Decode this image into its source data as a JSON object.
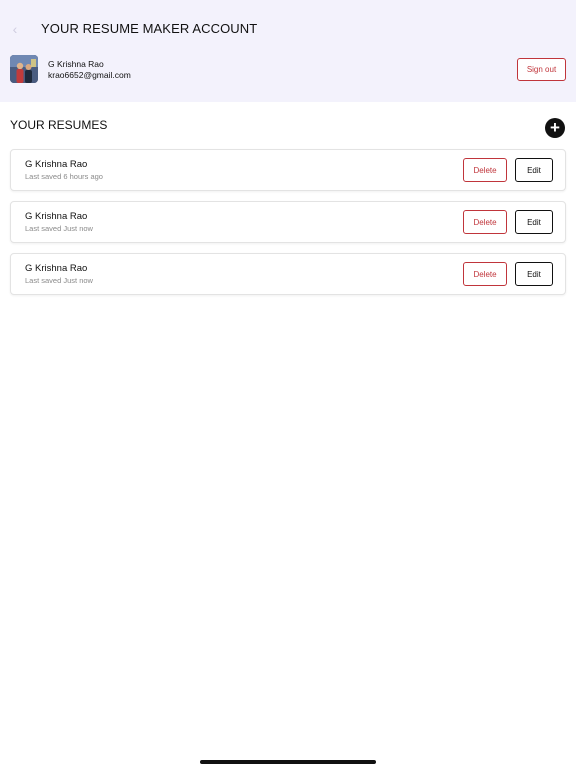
{
  "header": {
    "title": "YOUR RESUME MAKER ACCOUNT",
    "back_icon": "chevron-left-icon"
  },
  "profile": {
    "name": "G Krishna Rao",
    "email": "krao6652@gmail.com",
    "avatar_icon": "profile-photo"
  },
  "actions": {
    "sign_out_label": "Sign out",
    "add_icon": "plus-circle-icon"
  },
  "resumes_section": {
    "title": "YOUR RESUMES",
    "items": [
      {
        "name": "G Krishna Rao",
        "meta": "Last saved 6 hours ago",
        "delete_label": "Delete",
        "edit_label": "Edit"
      },
      {
        "name": "G Krishna Rao",
        "meta": "Last saved Just now",
        "delete_label": "Delete",
        "edit_label": "Edit"
      },
      {
        "name": "G Krishna Rao",
        "meta": "Last saved Just now",
        "delete_label": "Delete",
        "edit_label": "Edit"
      }
    ]
  },
  "colors": {
    "header_bg": "#f3f2fc",
    "danger": "#c0353b",
    "primary": "#111111",
    "muted_text": "#8a8a8a"
  }
}
